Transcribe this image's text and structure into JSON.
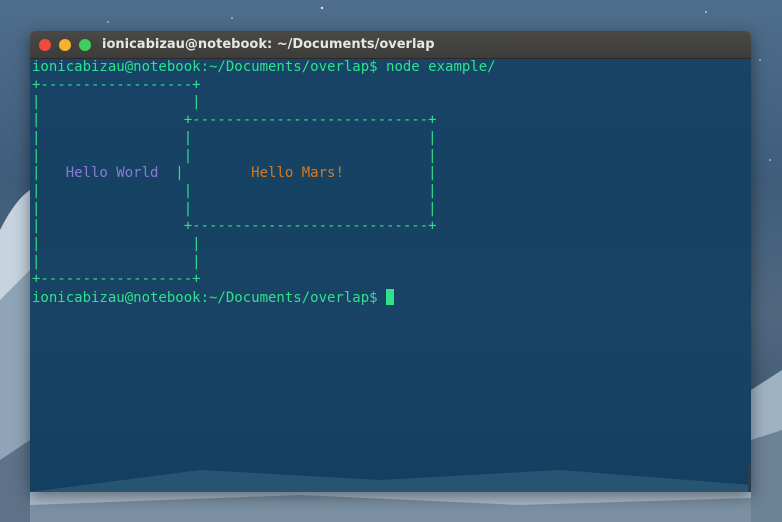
{
  "window": {
    "title": "ionicabizau@notebook: ~/Documents/overlap"
  },
  "terminal": {
    "prompt": "ionicabizau@notebook:~/Documents/overlap$",
    "command": "node example/",
    "lines": [
      "+------------------+",
      "|                  |",
      "|                 +----------------------------+",
      "|                 |                            |",
      "|                 |                            |",
      "|   ",
      "Hello World",
      "  |",
      "        ",
      "Hello Mars!",
      "          |",
      "|                 |                            |",
      "|                 |                            |",
      "|                 +----------------------------+",
      "|                  |",
      "|                  |",
      "+------------------+"
    ]
  },
  "colors": {
    "terminal_green": "#2fe08d",
    "hello_world": "#8a7ad8",
    "hello_mars": "#d87a1c",
    "terminal_bg": "#0e3c5f",
    "titlebar": "#3d3c39"
  }
}
